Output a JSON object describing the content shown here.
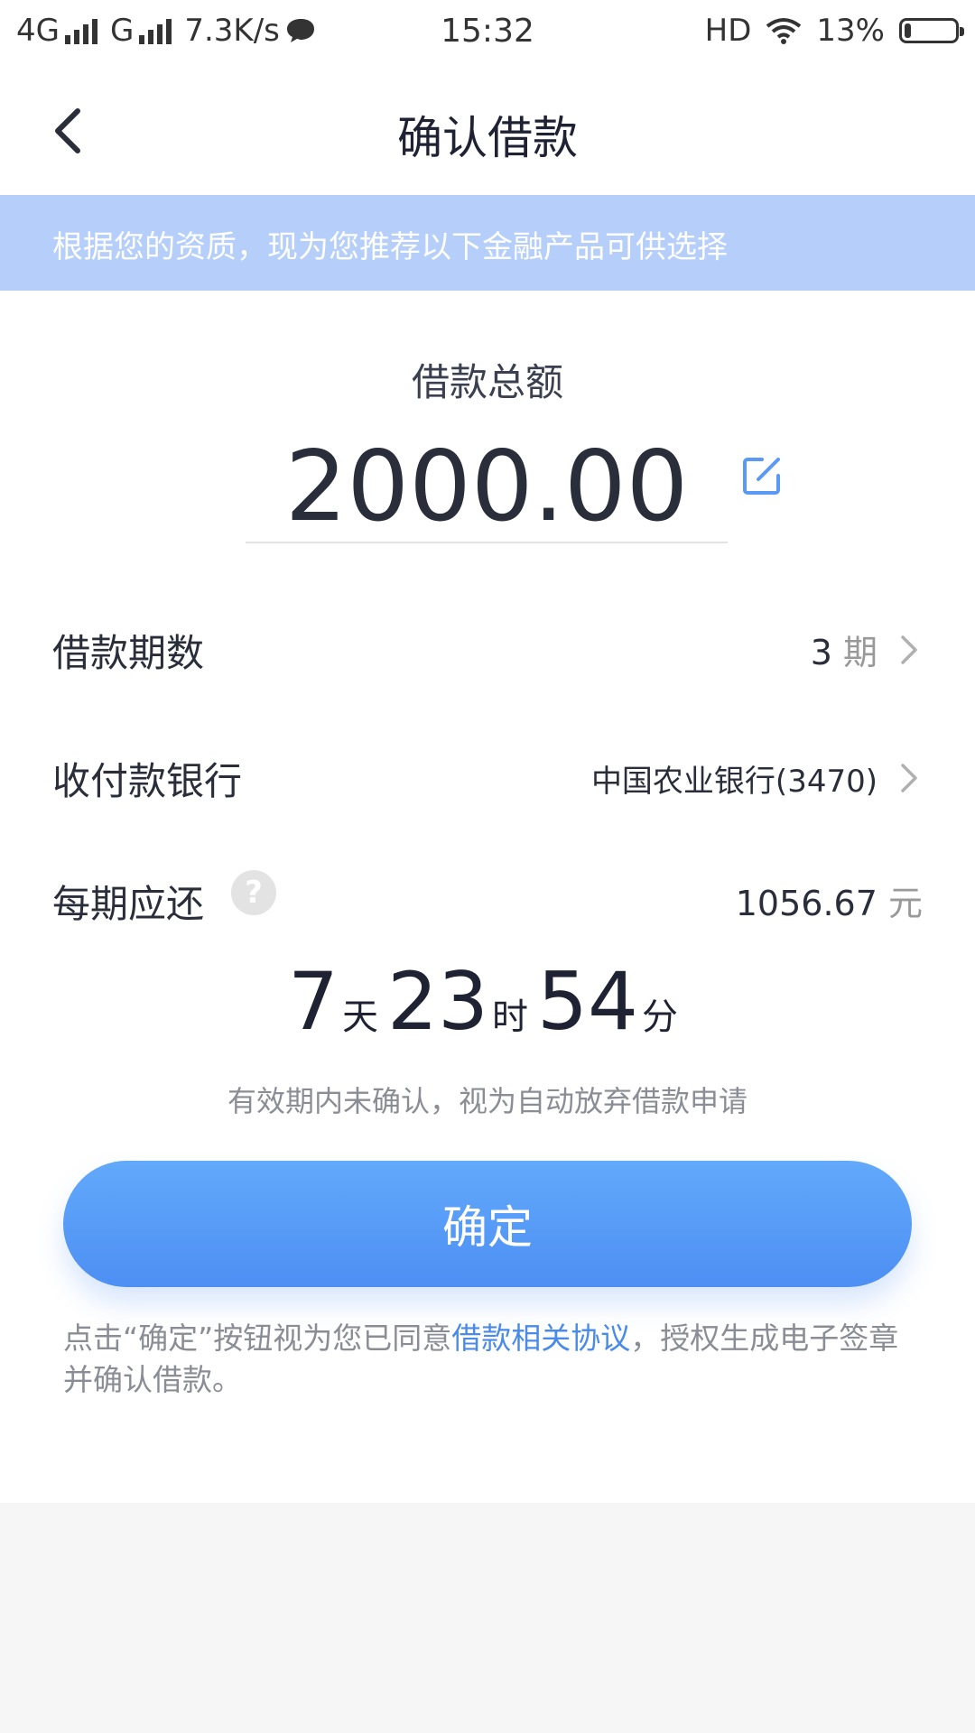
{
  "status_bar": {
    "network1": "4G",
    "network2": "G",
    "speed": "7.3K/s",
    "time": "15:32",
    "hd": "HD",
    "battery": "13%",
    "battery_level": 0.13
  },
  "nav": {
    "title": "确认借款"
  },
  "banner": {
    "text": "根据您的资质，现为您推荐以下金融产品可供选择"
  },
  "loan": {
    "amount_label": "借款总额",
    "amount": "2000.00"
  },
  "rows": {
    "term_label": "借款期数",
    "term_value": "3",
    "term_unit": "期",
    "bank_label": "收付款银行",
    "bank_value": "中国农业银行(3470)",
    "payment_label": "每期应还",
    "payment_help": "?",
    "payment_value": "1056.67",
    "payment_unit": "元"
  },
  "countdown": {
    "days": "7",
    "days_unit": "天",
    "hours": "23",
    "hours_unit": "时",
    "minutes": "54",
    "minutes_unit": "分"
  },
  "notice": "有效期内未确认，视为自动放弃借款申请",
  "confirm_button": "确定",
  "agreement": {
    "prefix": "点击“确定”按钮视为您已同意",
    "link": "借款相关协议",
    "suffix": "，授权生成电子签章并确认借款。"
  },
  "colors": {
    "accent": "#4d8ff3",
    "banner": "#b5cffa",
    "link": "#4a8ae8"
  },
  "icons": [
    "signal-icon",
    "chat-icon",
    "wifi-icon",
    "battery-icon",
    "back-icon",
    "edit-icon",
    "chevron-right-icon",
    "help-icon"
  ]
}
